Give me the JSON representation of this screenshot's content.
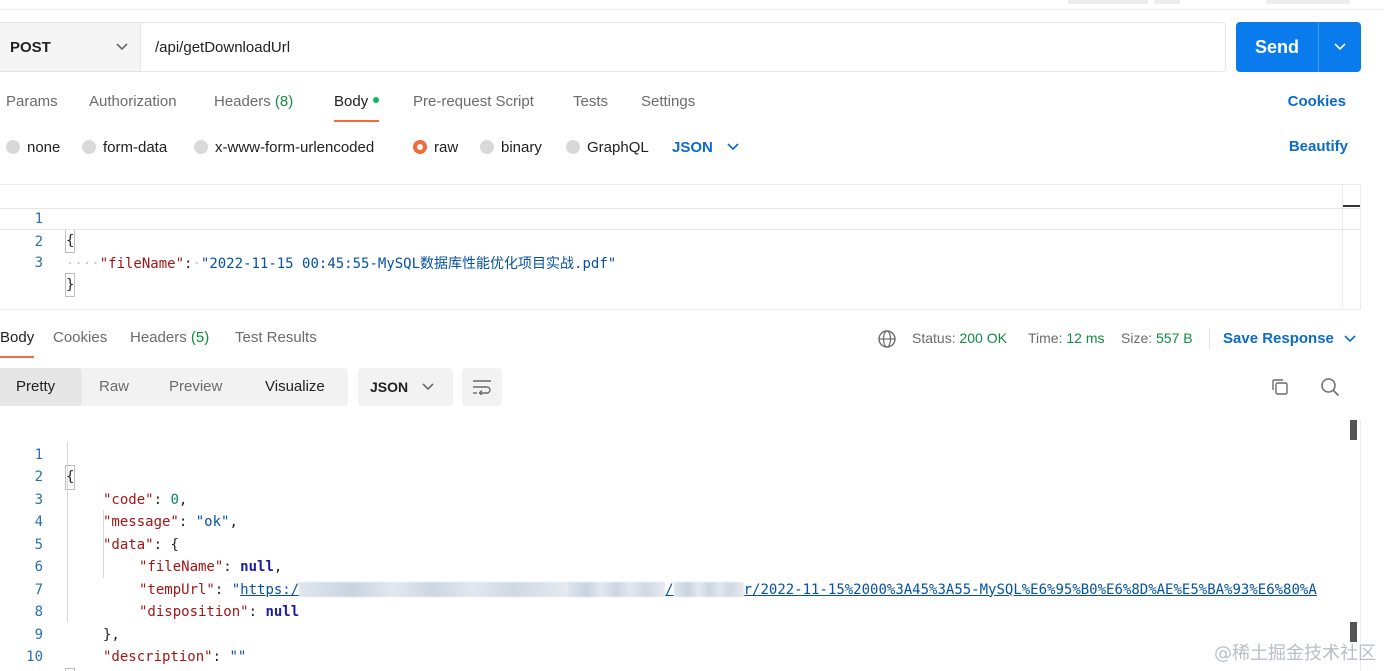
{
  "request": {
    "method": "POST",
    "url": "/api/getDownloadUrl",
    "send_label": "Send",
    "tabs": [
      {
        "label": "Params"
      },
      {
        "label": "Authorization"
      },
      {
        "label": "Headers",
        "count": "(8)"
      },
      {
        "label": "Body"
      },
      {
        "label": "Pre-request Script"
      },
      {
        "label": "Tests"
      },
      {
        "label": "Settings"
      }
    ],
    "cookies_label": "Cookies",
    "body_types": [
      "none",
      "form-data",
      "x-www-form-urlencoded",
      "raw",
      "binary",
      "GraphQL"
    ],
    "selected_body_type": "raw",
    "language": "JSON",
    "beautify_label": "Beautify",
    "editor": {
      "line_numbers": [
        "1",
        "2",
        "3"
      ],
      "open_brace": "{",
      "key": "\"fileName\"",
      "colon": ":",
      "value": "\"2022-11-15 00:45:55-MySQL数据库性能优化项目实战.pdf\"",
      "close_brace": "}"
    }
  },
  "response": {
    "tabs": [
      {
        "label": "Body"
      },
      {
        "label": "Cookies"
      },
      {
        "label": "Headers",
        "count": "(5)"
      },
      {
        "label": "Test Results"
      }
    ],
    "status_label": "Status:",
    "status_value": "200 OK",
    "time_label": "Time:",
    "time_value": "12 ms",
    "size_label": "Size:",
    "size_value": "557 B",
    "save_label": "Save Response",
    "views": [
      "Pretty",
      "Raw",
      "Preview",
      "Visualize"
    ],
    "format": "JSON",
    "line_numbers": [
      "1",
      "2",
      "3",
      "4",
      "5",
      "6",
      "7",
      "8",
      "9",
      "10"
    ],
    "code": {
      "l1": "{",
      "l2_key": "\"code\"",
      "l2_val": "0",
      "l3_key": "\"message\"",
      "l3_val": "\"ok\"",
      "l4_key": "\"data\"",
      "l4_val": "{",
      "l5_key": "\"fileName\"",
      "l5_val": "null",
      "l6_key": "\"tempUrl\"",
      "l6_quote": "\"",
      "l6_url_start": "https:/",
      "l6_url_mid": "/",
      "l6_url_end": "r/2022-11-15%2000%3A45%3A55-MySQL%E6%95%B0%E6%8D%AE%E5%BA%93%E6%80%A",
      "l7_key": "\"disposition\"",
      "l7_val": "null",
      "l8": "},",
      "l9_key": "\"description\"",
      "l9_val": "\"\"",
      "l10": "}"
    }
  },
  "watermark": "@稀土掘金技术社区"
}
